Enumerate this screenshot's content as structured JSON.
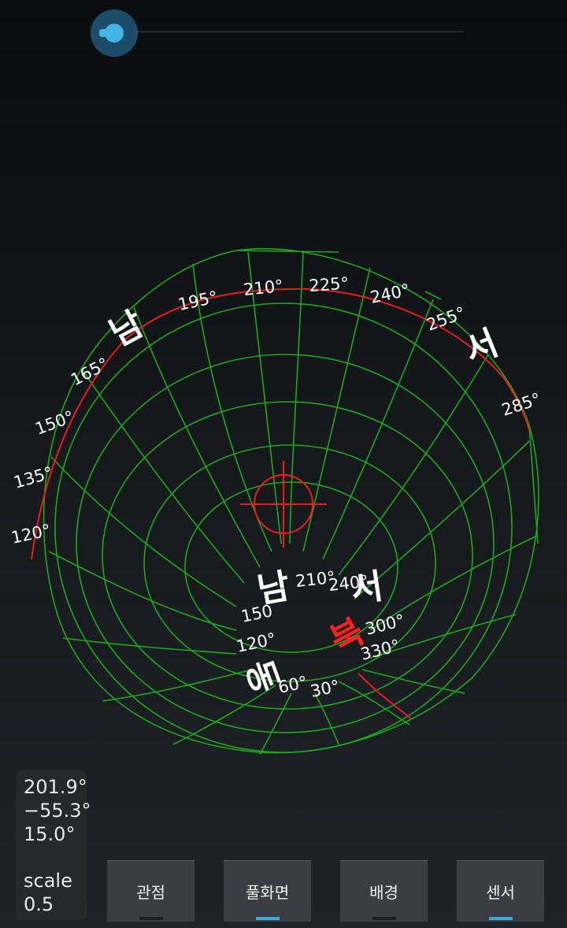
{
  "slider": {
    "value": 0.0
  },
  "sky": {
    "horizon_labels": [
      "195°",
      "210°",
      "225°",
      "240°",
      "255°",
      "285°",
      "165°",
      "150°",
      "135°",
      "120°"
    ],
    "inner_labels": [
      "210°",
      "240°",
      "150",
      "120°",
      "300°",
      "330°",
      "60°",
      "30°"
    ],
    "cardinals": {
      "south_outer": "남",
      "west_outer": "서",
      "south_inner": "남",
      "west_inner": "서",
      "east_inner": "동",
      "north_inner": "북"
    },
    "colors": {
      "grid": "#1fa81f",
      "horizon": "#e81e1e",
      "crosshair": "#ee1c1c",
      "north": "#ff2020"
    }
  },
  "readout": {
    "azimuth": "201.9°",
    "altitude": "−55.3°",
    "fov": "15.0°",
    "scale_label": "scale",
    "scale_value": "0.5"
  },
  "buttons": [
    {
      "label": "관점",
      "active": false
    },
    {
      "label": "풀화면",
      "active": true
    },
    {
      "label": "배경",
      "active": false
    },
    {
      "label": "센서",
      "active": true
    }
  ]
}
